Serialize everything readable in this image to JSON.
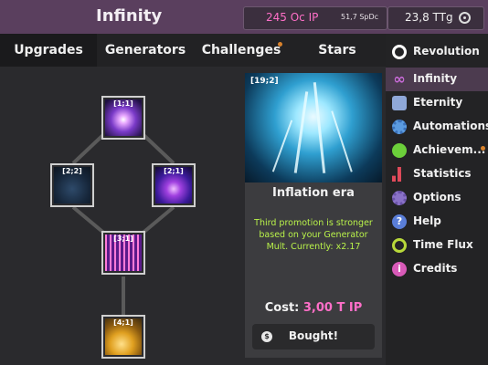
{
  "header": {
    "title": "Infinity",
    "ip_display": "245 Oc IP",
    "spdc_display": "51,7 SpDc",
    "ttg_display": "23,8 TTg"
  },
  "tabs": [
    {
      "label": "Upgrades",
      "active": true
    },
    {
      "label": "Generators",
      "active": false
    },
    {
      "label": "Challenges",
      "active": false,
      "notification": true
    },
    {
      "label": "Stars",
      "active": false
    }
  ],
  "tree": {
    "nodes": [
      {
        "id": "1-1",
        "label": "[1;1]"
      },
      {
        "id": "2-2",
        "label": "[2;2]"
      },
      {
        "id": "2-1",
        "label": "[2;1]"
      },
      {
        "id": "3-1",
        "label": "[3;1]"
      },
      {
        "id": "4-1",
        "label": "[4;1]"
      }
    ]
  },
  "detail": {
    "tag": "[19;2]",
    "title": "Inflation era",
    "description": "Third promotion is stronger based on your Generator Mult. Currently: x2.17",
    "cost_label": "Cost:",
    "cost_value": "3,00 T IP",
    "button_label": "Bought!",
    "button_icon": "$"
  },
  "sidebar": {
    "items": [
      {
        "label": "Revolution",
        "icon": "target-icon",
        "color": "#ffffff",
        "active": false
      },
      {
        "label": "Infinity",
        "icon": "infinity-icon",
        "color": "#c86bd8",
        "active": true
      },
      {
        "label": "Eternity",
        "icon": "robot-icon",
        "color": "#8fa8d8",
        "active": false
      },
      {
        "label": "Automations",
        "icon": "gear-icon",
        "color": "#5b9be0",
        "active": false
      },
      {
        "label": "Achievem...",
        "icon": "medal-icon",
        "color": "#6ccf3a",
        "active": false,
        "notification": true
      },
      {
        "label": "Statistics",
        "icon": "bar-chart-icon",
        "color": "#e04a5a",
        "active": false
      },
      {
        "label": "Options",
        "icon": "cog-icon",
        "color": "#8a72c8",
        "active": false
      },
      {
        "label": "Help",
        "icon": "question-icon",
        "color": "#5a7ed8",
        "active": false
      },
      {
        "label": "Time Flux",
        "icon": "stopwatch-icon",
        "color": "#b8d83a",
        "active": false
      },
      {
        "label": "Credits",
        "icon": "info-icon",
        "color": "#d85ab8",
        "active": false
      }
    ]
  }
}
